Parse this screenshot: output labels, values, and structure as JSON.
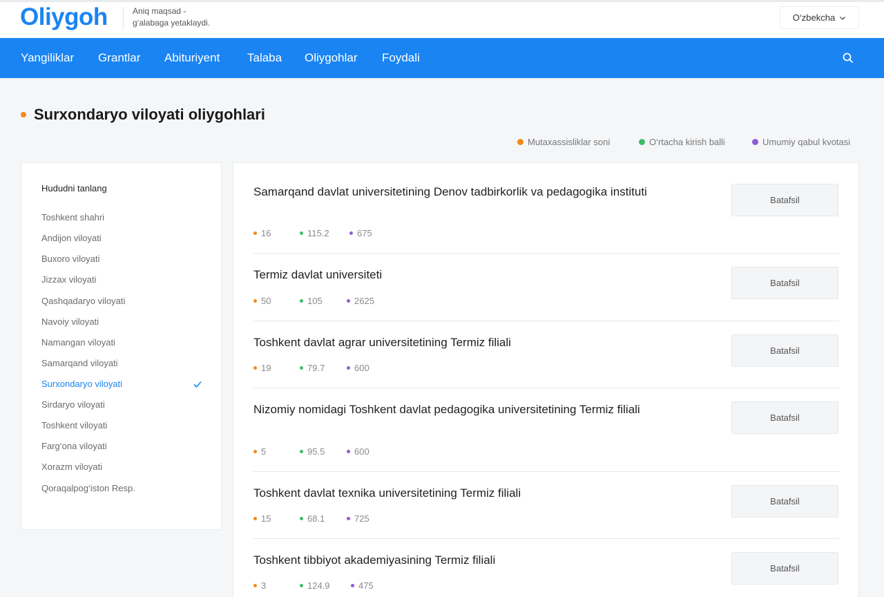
{
  "brand": {
    "logo": "Oliygoh",
    "tagline_line1": "Aniq maqsad -",
    "tagline_line2": "g‘alabaga yetaklaydi."
  },
  "language": {
    "selected": "O‘zbekcha",
    "icon": "chevron-down-icon"
  },
  "nav": {
    "items": [
      "Yangiliklar",
      "Grantlar",
      "Abituriyent",
      "Talaba",
      "Oliygohlar",
      "Foydali"
    ],
    "search_icon": "search-icon"
  },
  "page": {
    "title": "Surxondaryo viloyati oliygohlari"
  },
  "legend": {
    "specialties": "Mutaxassisliklar soni",
    "avg_score": "O‘rtacha kirish balli",
    "quota": "Umumiy qabul kvotasi"
  },
  "colors": {
    "accent": "#1a84f3",
    "specialties": "#f28a1b",
    "avg_score": "#3ebd6a",
    "quota": "#8e5bd6"
  },
  "sidebar": {
    "heading": "Hududni tanlang",
    "items": [
      "Toshkent shahri",
      "Andijon viloyati",
      "Buxoro viloyati",
      "Jizzax viloyati",
      "Qashqadaryo viloyati",
      "Navoiy viloyati",
      "Namangan viloyati",
      "Samarqand viloyati",
      "Surxondaryo viloyati",
      "Sirdaryo viloyati",
      "Toshkent viloyati",
      "Farg‘ona viloyati",
      "Xorazm viloyati",
      "Qoraqalpog‘iston Resp."
    ],
    "selected": "Surxondaryo viloyati"
  },
  "universities": [
    {
      "name": "Samarqand davlat universitetining Denov tadbirkorlik va pedagogika instituti",
      "specialties": "16",
      "avg_score": "115.2",
      "quota": "675",
      "button": "Batafsil"
    },
    {
      "name": "Termiz davlat universiteti",
      "specialties": "50",
      "avg_score": "105",
      "quota": "2625",
      "button": "Batafsil"
    },
    {
      "name": "Toshkent davlat agrar universitetining Termiz filiali",
      "specialties": "19",
      "avg_score": "79.7",
      "quota": "600",
      "button": "Batafsil"
    },
    {
      "name": "Nizomiy nomidagi Toshkent davlat pedagogika universitetining Termiz filiali",
      "specialties": "5",
      "avg_score": "95.5",
      "quota": "600",
      "button": "Batafsil"
    },
    {
      "name": "Toshkent davlat texnika universitetining Termiz filiali",
      "specialties": "15",
      "avg_score": "68.1",
      "quota": "725",
      "button": "Batafsil"
    },
    {
      "name": "Toshkent tibbiyot akademiyasining Termiz filiali",
      "specialties": "3",
      "avg_score": "124.9",
      "quota": "475",
      "button": "Batafsil"
    }
  ]
}
